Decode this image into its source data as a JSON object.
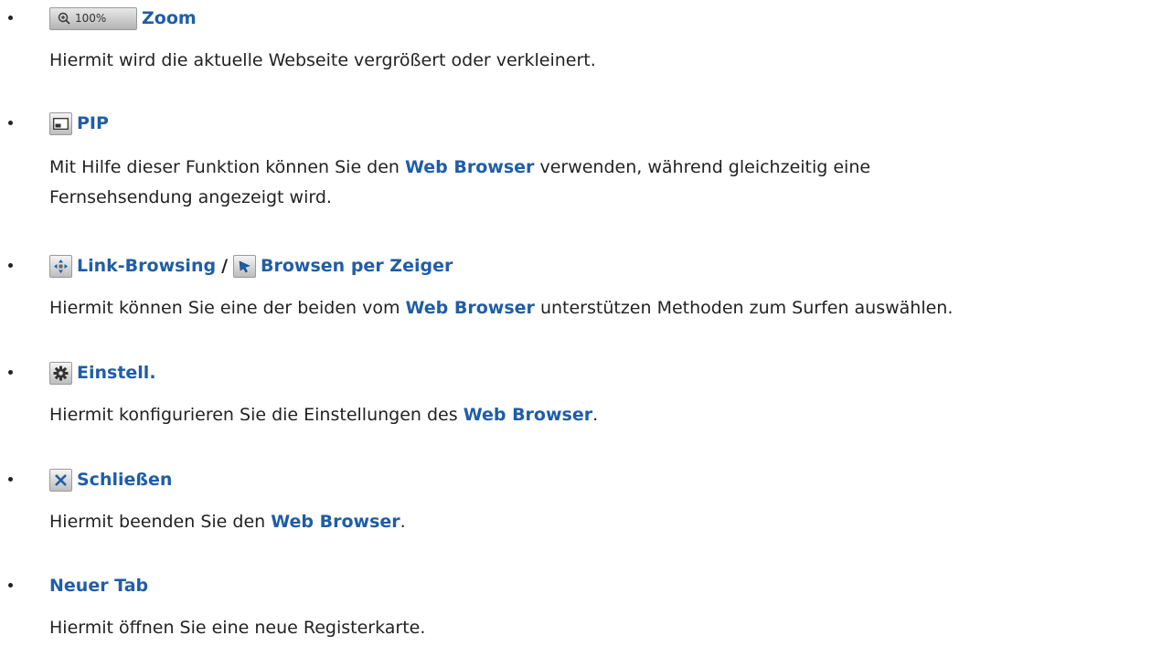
{
  "items": [
    {
      "icon": "zoom-icon",
      "icon_text": "100%",
      "title": "Zoom",
      "desc": "Hiermit wird die aktuelle Webseite vergrößert oder verkleinert."
    },
    {
      "icon": "pip-icon",
      "title": "PIP",
      "desc_line1_a": "Mit Hilfe dieser Funktion können Sie den ",
      "desc_line1_b": "Web Browser",
      "desc_line1_c": " verwenden, während gleichzeitig eine",
      "desc_line2": "Fernsehsendung angezeigt wird."
    },
    {
      "icon": "link-browsing-icon",
      "title": "Link-Browsing",
      "separator": "/",
      "icon2": "pointer-icon",
      "title2": "Browsen per Zeiger",
      "desc_a": "Hiermit können Sie eine der beiden vom ",
      "desc_b": "Web Browser",
      "desc_c": " unterstützen Methoden zum Surfen auswählen."
    },
    {
      "icon": "gear-icon",
      "title": "Einstell.",
      "desc_a": "Hiermit konfigurieren Sie die Einstellungen des ",
      "desc_b": "Web Browser",
      "desc_c": "."
    },
    {
      "icon": "close-icon",
      "title": "Schließen",
      "desc_a": "Hiermit beenden Sie den ",
      "desc_b": "Web Browser",
      "desc_c": "."
    },
    {
      "title": "Neuer Tab",
      "desc": "Hiermit öffnen Sie eine neue Registerkarte."
    }
  ]
}
